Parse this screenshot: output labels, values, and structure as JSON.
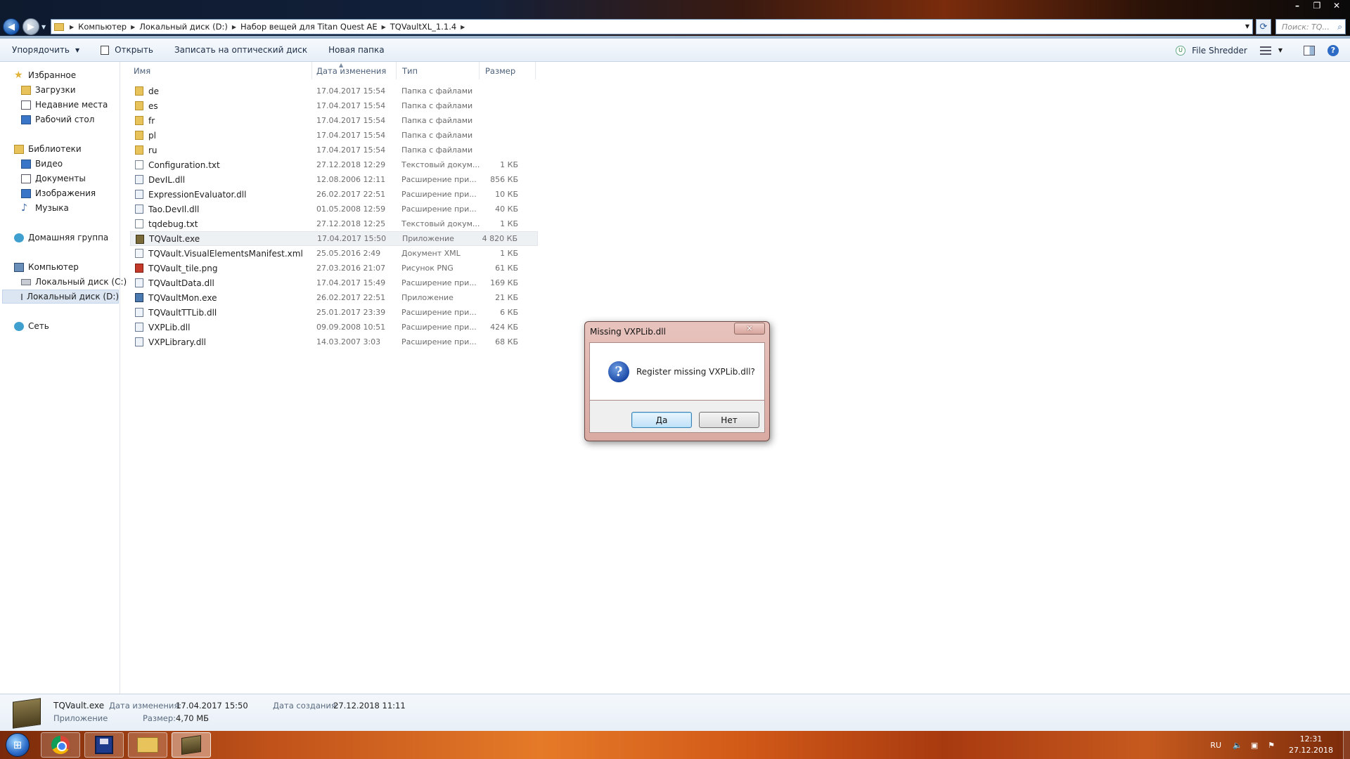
{
  "window": {
    "controls": [
      "–",
      "❐",
      "✕"
    ]
  },
  "address": {
    "crumbs": [
      "Компьютер",
      "Локальный диск (D:)",
      "Набор вещей для Titan Quest AE",
      "TQVaultXL_1.1.4"
    ],
    "search_placeholder": "Поиск: TQ..."
  },
  "toolbar": {
    "organize": "Упорядочить",
    "open": "Открыть",
    "burn": "Записать на оптический диск",
    "new_folder": "Новая папка",
    "file_shredder": "File Shredder"
  },
  "navpane": {
    "favorites": "Избранное",
    "downloads": "Загрузки",
    "recent": "Недавние места",
    "desktop": "Рабочий стол",
    "libraries": "Библиотеки",
    "video": "Видео",
    "documents": "Документы",
    "pictures": "Изображения",
    "music": "Музыка",
    "homegroup": "Домашняя группа",
    "computer": "Компьютер",
    "drive_c": "Локальный диск (C:)",
    "drive_d": "Локальный диск (D:)",
    "network": "Сеть"
  },
  "columns": {
    "name": "Имя",
    "date": "Дата изменения",
    "type": "Тип",
    "size": "Размер"
  },
  "files": [
    {
      "name": "de",
      "date": "17.04.2017 15:54",
      "type": "Папка с файлами",
      "size": "",
      "icon": "folder"
    },
    {
      "name": "es",
      "date": "17.04.2017 15:54",
      "type": "Папка с файлами",
      "size": "",
      "icon": "folder"
    },
    {
      "name": "fr",
      "date": "17.04.2017 15:54",
      "type": "Папка с файлами",
      "size": "",
      "icon": "folder"
    },
    {
      "name": "pl",
      "date": "17.04.2017 15:54",
      "type": "Папка с файлами",
      "size": "",
      "icon": "folder"
    },
    {
      "name": "ru",
      "date": "17.04.2017 15:54",
      "type": "Папка с файлами",
      "size": "",
      "icon": "folder"
    },
    {
      "name": "Configuration.txt",
      "date": "27.12.2018 12:29",
      "type": "Текстовый докум...",
      "size": "1 КБ",
      "icon": "txt"
    },
    {
      "name": "DevIL.dll",
      "date": "12.08.2006 12:11",
      "type": "Расширение при...",
      "size": "856 КБ",
      "icon": "dll"
    },
    {
      "name": "ExpressionEvaluator.dll",
      "date": "26.02.2017 22:51",
      "type": "Расширение при...",
      "size": "10 КБ",
      "icon": "dll"
    },
    {
      "name": "Tao.DevIl.dll",
      "date": "01.05.2008 12:59",
      "type": "Расширение при...",
      "size": "40 КБ",
      "icon": "dll"
    },
    {
      "name": "tqdebug.txt",
      "date": "27.12.2018 12:25",
      "type": "Текстовый докум...",
      "size": "1 КБ",
      "icon": "txt"
    },
    {
      "name": "TQVault.exe",
      "date": "17.04.2017 15:50",
      "type": "Приложение",
      "size": "4 820 КБ",
      "icon": "exe",
      "selected": true
    },
    {
      "name": "TQVault.VisualElementsManifest.xml",
      "date": "25.05.2016 2:49",
      "type": "Документ XML",
      "size": "1 КБ",
      "icon": "xml"
    },
    {
      "name": "TQVault_tile.png",
      "date": "27.03.2016 21:07",
      "type": "Рисунок PNG",
      "size": "61 КБ",
      "icon": "png"
    },
    {
      "name": "TQVaultData.dll",
      "date": "17.04.2017 15:49",
      "type": "Расширение при...",
      "size": "169 КБ",
      "icon": "dll"
    },
    {
      "name": "TQVaultMon.exe",
      "date": "26.02.2017 22:51",
      "type": "Приложение",
      "size": "21 КБ",
      "icon": "mon"
    },
    {
      "name": "TQVaultTTLib.dll",
      "date": "25.01.2017 23:39",
      "type": "Расширение при...",
      "size": "6 КБ",
      "icon": "dll"
    },
    {
      "name": "VXPLib.dll",
      "date": "09.09.2008 10:51",
      "type": "Расширение при...",
      "size": "424 КБ",
      "icon": "dll"
    },
    {
      "name": "VXPLibrary.dll",
      "date": "14.03.2007 3:03",
      "type": "Расширение при...",
      "size": "68 КБ",
      "icon": "dll"
    }
  ],
  "dialog": {
    "title": "Missing VXPLib.dll",
    "close": "✕",
    "message": "Register missing VXPLib.dll?",
    "yes": "Да",
    "no": "Нет"
  },
  "details": {
    "name": "TQVault.exe",
    "type": "Приложение",
    "modified_label": "Дата изменения:",
    "modified_value": "17.04.2017 15:50",
    "size_label": "Размер:",
    "size_value": "4,70 МБ",
    "created_label": "Дата создания:",
    "created_value": "27.12.2018 11:11"
  },
  "taskbar": {
    "lang": "RU",
    "time": "12:31",
    "date": "27.12.2018"
  }
}
